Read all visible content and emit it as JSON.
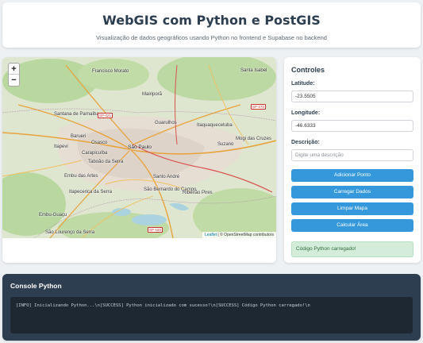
{
  "header": {
    "title": "WebGIS com Python e PostGIS",
    "subtitle": "Visualização de dados geográficos usando Python no frontend e Supabase no backend"
  },
  "map": {
    "zoom_in": "+",
    "zoom_out": "−",
    "attribution_leaflet": "Leaflet",
    "attribution_rest": " | © OpenStreetMap contributors",
    "labels": {
      "francisco_morato": "Francisco Morato",
      "santa_isabel": "Santa Isabel",
      "mairipora": "Mairiporã",
      "santana_parnaiba": "Santana de Parnaíba",
      "barueri": "Barueri",
      "osasco": "Osasco",
      "guarulhos": "Guarulhos",
      "itaquaquecetuba": "Itaquaquecetuba",
      "itapevi": "Itapevi",
      "carapicuiba": "Carapicuíba",
      "sao_paulo": "São Paulo",
      "suzano": "Suzano",
      "mogi": "Mogi das Cruzes",
      "taboao": "Taboão da Serra",
      "embu": "Embu das Artes",
      "santo_andre": "Santo André",
      "itapecerica": "Itapecerica da Serra",
      "sao_bernardo": "São Bernardo do Campo",
      "ribeirao_pires": "Ribeirão Pires",
      "embu_guacu": "Embu-Guaçu",
      "sao_lourenco": "São Lourenço da Serra"
    },
    "roads": {
      "sp021": "SP-021",
      "sp070": "SP-070",
      "sp160": "SP-160"
    }
  },
  "controls": {
    "title": "Controles",
    "latitude_label": "Latitude:",
    "latitude_value": "-23.5505",
    "longitude_label": "Longitude:",
    "longitude_value": "-46.6333",
    "description_label": "Descrição:",
    "description_placeholder": "Digite uma descrição",
    "buttons": {
      "add": "Adicionar Ponto",
      "load": "Carregar Dados",
      "clear": "Limpar Mapa",
      "area": "Calcular Área"
    },
    "status": "Código Python carregado!"
  },
  "console": {
    "title": "Console Python",
    "output": "[INFO] Inicializando Python...\\n[SUCCESS] Python inicializado com sucesso!\\n[SUCCESS] Código Python carregado!\\n"
  },
  "colors": {
    "primary_button": "#3498db",
    "heading": "#2c3e50",
    "status_bg": "#d4edda",
    "console_bg": "#2c3e50"
  }
}
